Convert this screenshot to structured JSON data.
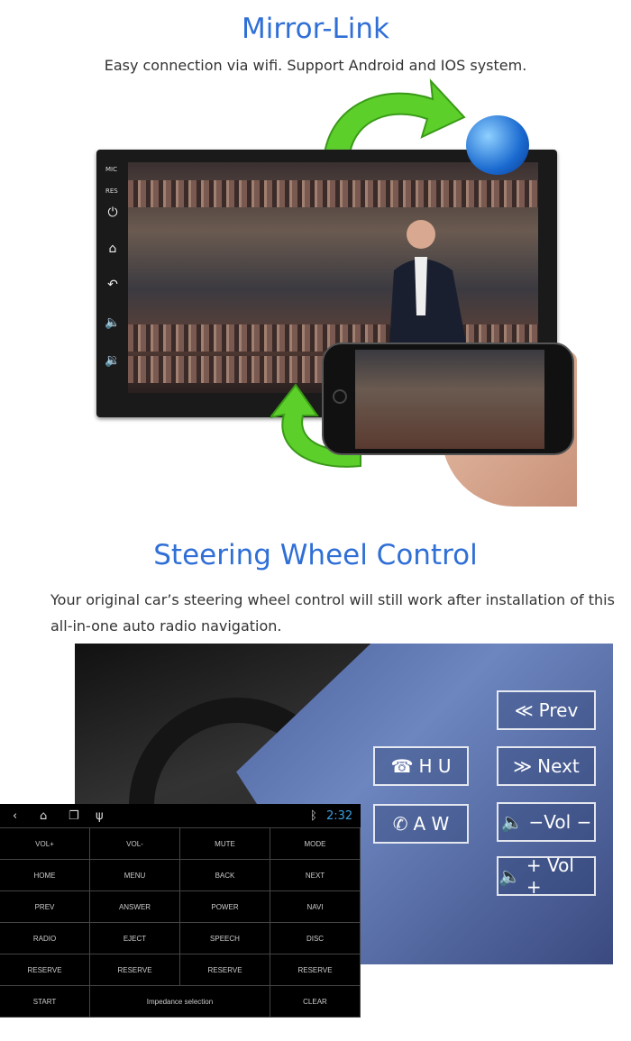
{
  "mirror": {
    "title": "Mirror-Link",
    "subtitle": "Easy connection via wifi. Support Android and IOS system.",
    "side_labels": [
      "MIC",
      "RES"
    ],
    "side_icons": [
      "power-icon",
      "home-icon",
      "back-icon",
      "volume-up-icon",
      "volume-down-icon"
    ]
  },
  "steering": {
    "title": "Steering Wheel Control",
    "subtitle_line1": "Your original car’s steering wheel control will still work after installation of this",
    "subtitle_line2": "all-in-one auto radio navigation.",
    "controls": {
      "prev": "Prev",
      "next": "Next",
      "hu": "H U",
      "aw": "A W",
      "vol_down": "−Vol −",
      "vol_up": "+ Vol +"
    }
  },
  "panel": {
    "time": "2:32",
    "time_color": "#3aa0e0",
    "cells": [
      "VOL+",
      "VOL-",
      "MUTE",
      "MODE",
      "HOME",
      "MENU",
      "BACK",
      "NEXT",
      "PREV",
      "ANSWER",
      "POWER",
      "NAVI",
      "RADIO",
      "EJECT",
      "SPEECH",
      "DISC",
      "RESERVE",
      "RESERVE",
      "RESERVE",
      "RESERVE"
    ],
    "bottom": {
      "start": "START",
      "impedance": "Impedance selection",
      "clear": "CLEAR"
    }
  },
  "colors": {
    "title_blue": "#2f6fd6",
    "arrow_green": "#5ccf2a"
  }
}
